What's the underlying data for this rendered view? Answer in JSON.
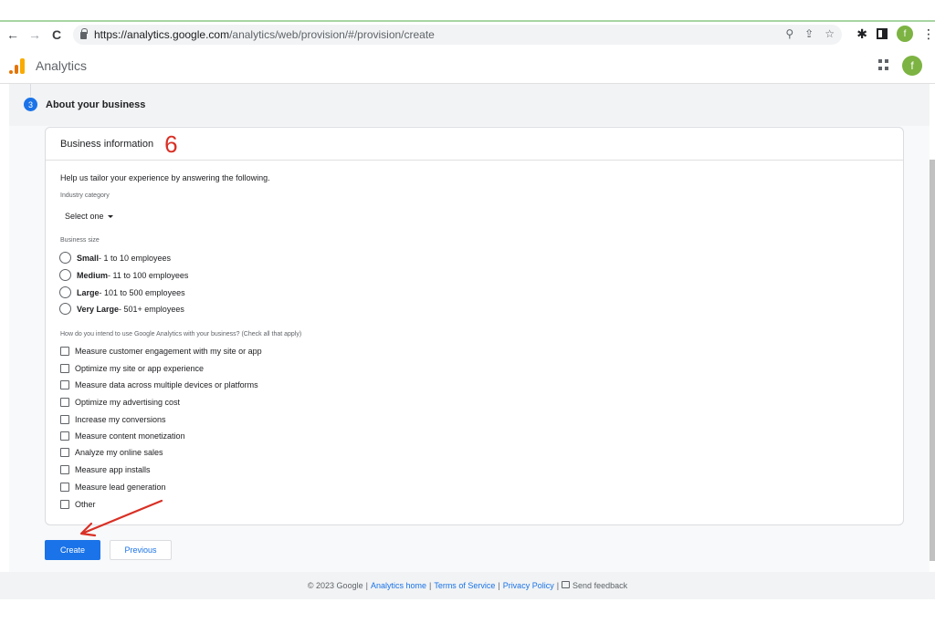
{
  "browser": {
    "url_host": "https://analytics.google.com",
    "url_path": "/analytics/web/provision/#/provision/create",
    "back_icon": "←",
    "forward_icon": "→",
    "reload_icon": "C",
    "zoom_icon": "⚲",
    "share_icon": "⇪",
    "star_icon": "☆",
    "extensions_icon": "✱",
    "profile_initial": "f",
    "menu_icon": "⋮"
  },
  "app": {
    "name": "Analytics",
    "profile_initial": "f"
  },
  "step": {
    "number": "3",
    "title": "About your business"
  },
  "card": {
    "title": "Business information",
    "annotation": "6",
    "intro": "Help us tailor your experience by answering the following.",
    "industry_label": "Industry category",
    "industry_value": "Select one",
    "size_label": "Business size",
    "sizes": [
      {
        "bold": "Small",
        "rest": " - 1 to 10 employees"
      },
      {
        "bold": "Medium",
        "rest": " - 11 to 100 employees"
      },
      {
        "bold": "Large",
        "rest": " - 101 to 500 employees"
      },
      {
        "bold": "Very Large",
        "rest": " - 501+ employees"
      }
    ],
    "usage_label": "How do you intend to use Google Analytics with your business? (Check all that apply)",
    "usages": [
      "Measure customer engagement with my site or app",
      "Optimize my site or app experience",
      "Measure data across multiple devices or platforms",
      "Optimize my advertising cost",
      "Increase my conversions",
      "Measure content monetization",
      "Analyze my online sales",
      "Measure app installs",
      "Measure lead generation",
      "Other"
    ]
  },
  "buttons": {
    "create": "Create",
    "previous": "Previous"
  },
  "footer": {
    "copyright": "© 2023 Google",
    "analytics_home": "Analytics home",
    "terms": "Terms of Service",
    "privacy": "Privacy Policy",
    "feedback": "Send feedback",
    "separator": "|"
  }
}
